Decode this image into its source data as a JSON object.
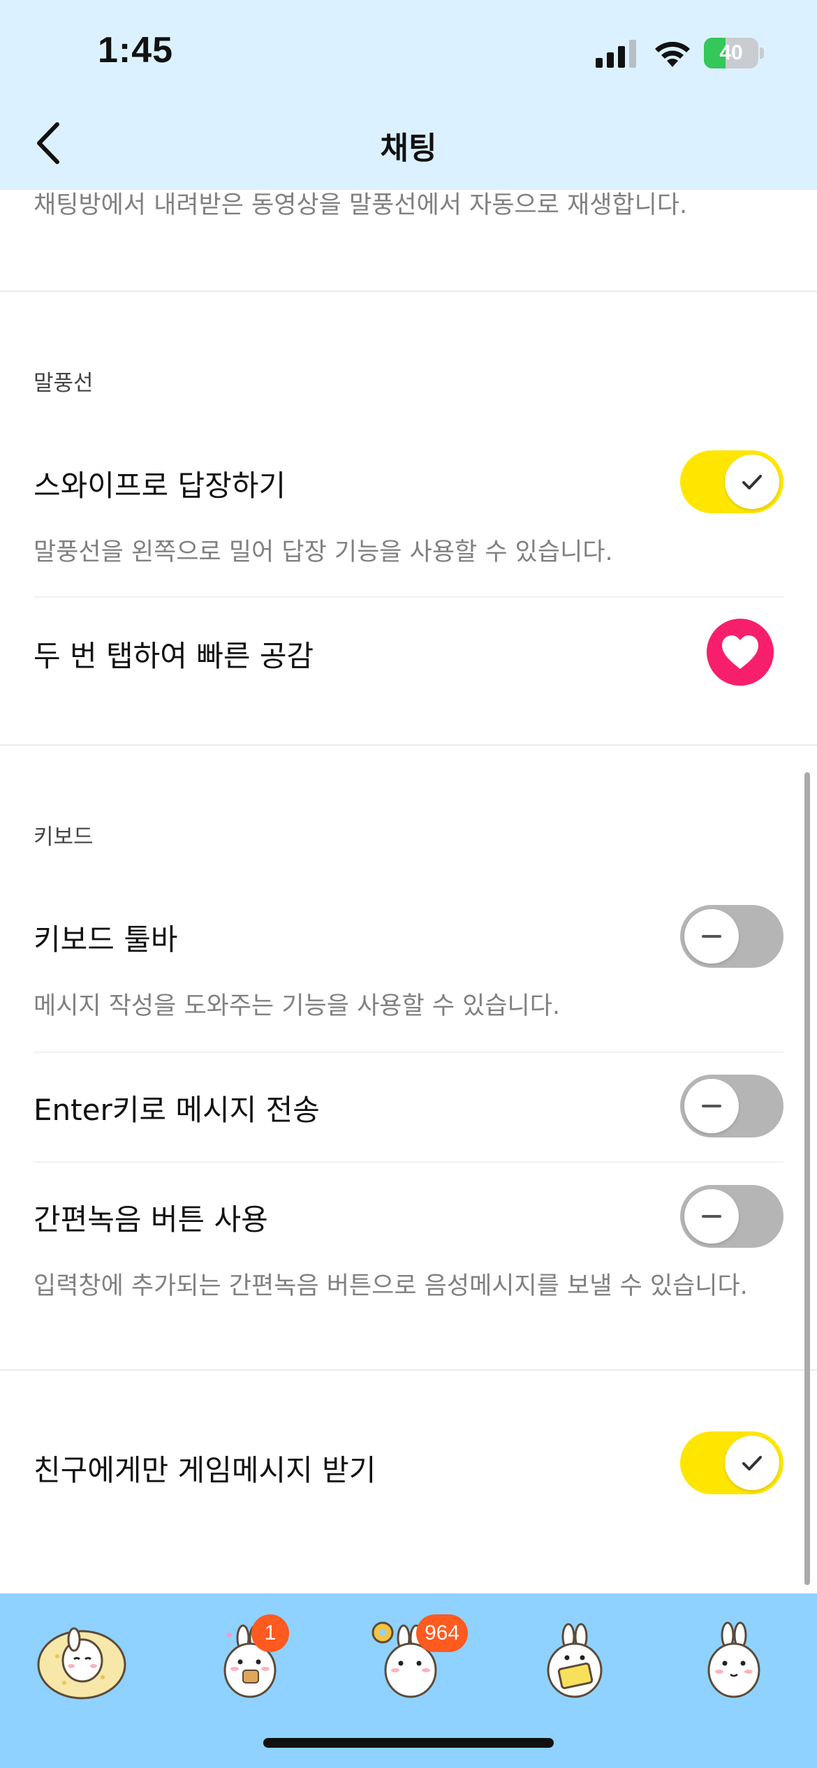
{
  "status_bar": {
    "time": "1:45",
    "battery": "40",
    "battery_level": 0.4
  },
  "header": {
    "title": "채팅"
  },
  "top_desc": "채팅방에서 내려받은 동영상을 말풍선에서 자동으로 재생합니다.",
  "sections": {
    "bubble": {
      "label": "말풍선",
      "swipe_reply": {
        "title": "스와이프로 답장하기",
        "desc": "말풍선을 왼쪽으로 밀어 답장 기능을 사용할 수 있습니다.",
        "enabled": true
      },
      "double_tap": {
        "title": "두 번 탭하여 빠른 공감",
        "icon": "heart-icon",
        "color": "#f71f6c"
      }
    },
    "keyboard": {
      "label": "키보드",
      "toolbar": {
        "title": "키보드 툴바",
        "desc": "메시지 작성을 도와주는 기능을 사용할 수 있습니다.",
        "enabled": false
      },
      "enter_send": {
        "title": "Enter키로 메시지 전송",
        "enabled": false
      },
      "quick_record": {
        "title": "간편녹음 버튼 사용",
        "desc": "입력창에 추가되는 간편녹음 버튼으로 음성메시지를 보낼 수 있습니다.",
        "enabled": false
      }
    },
    "game": {
      "friends_only": {
        "title": "친구에게만 게임메시지 받기",
        "enabled": true
      }
    }
  },
  "tabbar": {
    "tabs": [
      {
        "name": "friends",
        "icon": "bunny-pillow-icon"
      },
      {
        "name": "chats",
        "icon": "bunny-eating-icon",
        "badge": "1"
      },
      {
        "name": "openchat",
        "icon": "bunny-donut-icon",
        "badge": "964"
      },
      {
        "name": "shopping",
        "icon": "bunny-tablet-icon"
      },
      {
        "name": "more",
        "icon": "bunny-icon"
      }
    ]
  },
  "colors": {
    "accent_yellow": "#ffe600",
    "header_bg": "#dcf1ff",
    "tabbar_bg": "#8fd2ff",
    "badge": "#ff5a1f"
  }
}
